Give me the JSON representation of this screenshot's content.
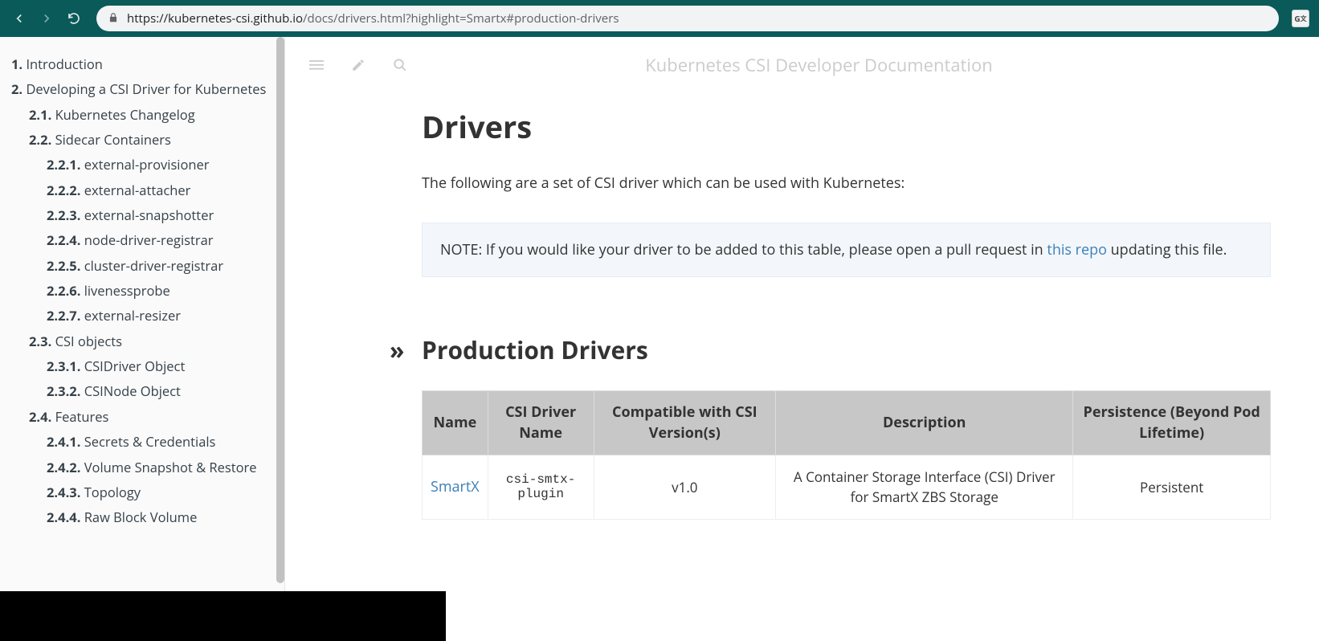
{
  "browser": {
    "url_domain": "kubernetes-csi.github.io",
    "url_path": "/docs/drivers.html?highlight=Smartx#production-drivers"
  },
  "book_title": "Kubernetes CSI Developer Documentation",
  "sidebar": [
    {
      "num": "1.",
      "label": "Introduction",
      "lvl": 1
    },
    {
      "num": "2.",
      "label": "Developing a CSI Driver for Kubernetes",
      "lvl": 1
    },
    {
      "num": "2.1.",
      "label": "Kubernetes Changelog",
      "lvl": 2
    },
    {
      "num": "2.2.",
      "label": "Sidecar Containers",
      "lvl": 2
    },
    {
      "num": "2.2.1.",
      "label": "external-provisioner",
      "lvl": 3
    },
    {
      "num": "2.2.2.",
      "label": "external-attacher",
      "lvl": 3
    },
    {
      "num": "2.2.3.",
      "label": "external-snapshotter",
      "lvl": 3
    },
    {
      "num": "2.2.4.",
      "label": "node-driver-registrar",
      "lvl": 3
    },
    {
      "num": "2.2.5.",
      "label": "cluster-driver-registrar",
      "lvl": 3
    },
    {
      "num": "2.2.6.",
      "label": "livenessprobe",
      "lvl": 3
    },
    {
      "num": "2.2.7.",
      "label": "external-resizer",
      "lvl": 3
    },
    {
      "num": "2.3.",
      "label": "CSI objects",
      "lvl": 2
    },
    {
      "num": "2.3.1.",
      "label": "CSIDriver Object",
      "lvl": 3
    },
    {
      "num": "2.3.2.",
      "label": "CSINode Object",
      "lvl": 3
    },
    {
      "num": "2.4.",
      "label": "Features",
      "lvl": 2
    },
    {
      "num": "2.4.1.",
      "label": "Secrets & Credentials",
      "lvl": 3
    },
    {
      "num": "2.4.2.",
      "label": "Volume Snapshot & Restore",
      "lvl": 3
    },
    {
      "num": "2.4.3.",
      "label": "Topology",
      "lvl": 3
    },
    {
      "num": "2.4.4.",
      "label": "Raw Block Volume",
      "lvl": 3
    }
  ],
  "page": {
    "heading": "Drivers",
    "intro": "The following are a set of CSI driver which can be used with Kubernetes:",
    "note_prefix": "NOTE: If you would like your driver to be added to this table, please open a pull request in ",
    "note_link": "this repo",
    "note_suffix": " updating this file.",
    "section_heading": "Production Drivers"
  },
  "table": {
    "headers": [
      "Name",
      "CSI Driver Name",
      "Compatible with CSI Version(s)",
      "Description",
      "Persistence (Beyond Pod Lifetime)"
    ],
    "rows": [
      {
        "name": "SmartX",
        "driver": "csi-smtx-plugin",
        "version": "v1.0",
        "desc": "A Container Storage Interface (CSI) Driver for SmartX ZBS Storage",
        "persistence": "Persistent"
      }
    ]
  }
}
